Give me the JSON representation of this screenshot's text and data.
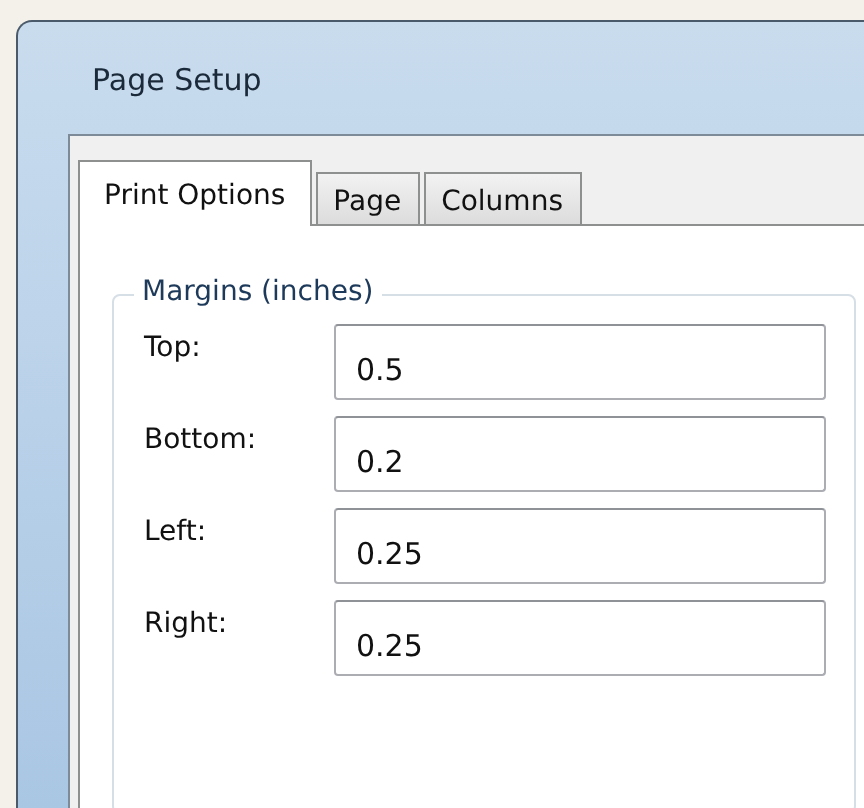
{
  "window": {
    "title": "Page Setup"
  },
  "tabs": [
    {
      "label": "Print Options",
      "selected": true
    },
    {
      "label": "Page",
      "selected": false
    },
    {
      "label": "Columns",
      "selected": false
    }
  ],
  "group": {
    "title": "Margins (inches)",
    "fields": [
      {
        "label": "Top:",
        "value": "0.5"
      },
      {
        "label": "Bottom:",
        "value": "0.2"
      },
      {
        "label": "Left:",
        "value": "0.25"
      },
      {
        "label": "Right:",
        "value": "0.25"
      }
    ]
  }
}
